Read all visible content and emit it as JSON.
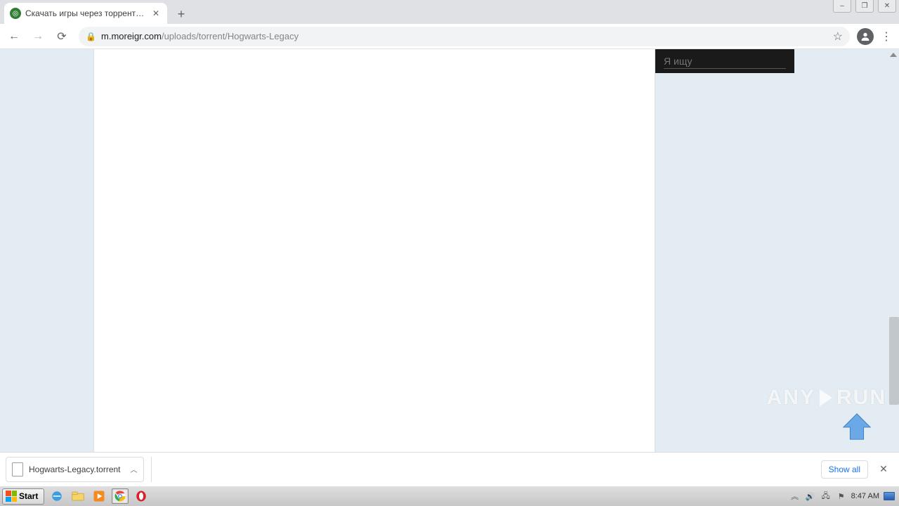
{
  "window": {
    "min": "–",
    "max": "❐",
    "close": "✕"
  },
  "tab": {
    "title": "Скачать игры через торрент бесп",
    "close": "✕"
  },
  "newtab_plus": "+",
  "nav": {
    "back": "←",
    "forward": "→",
    "reload": "⟳"
  },
  "url": {
    "host": "m.moreigr.com",
    "path": "/uploads/torrent/Hogwarts-Legacy"
  },
  "star": "☆",
  "kebab": "⋮",
  "search_placeholder": "Я ищу",
  "download": {
    "filename": "Hogwarts-Legacy.torrent",
    "chev": "︿",
    "showall": "Show all",
    "close": "✕"
  },
  "taskbar": {
    "start": "Start",
    "clock": "8:47 AM"
  },
  "watermark": {
    "left": "ANY",
    "right": "RUN"
  },
  "tray": {
    "up": "︽",
    "vol": "🔊",
    "net": "🖧",
    "flag": "⚑"
  }
}
